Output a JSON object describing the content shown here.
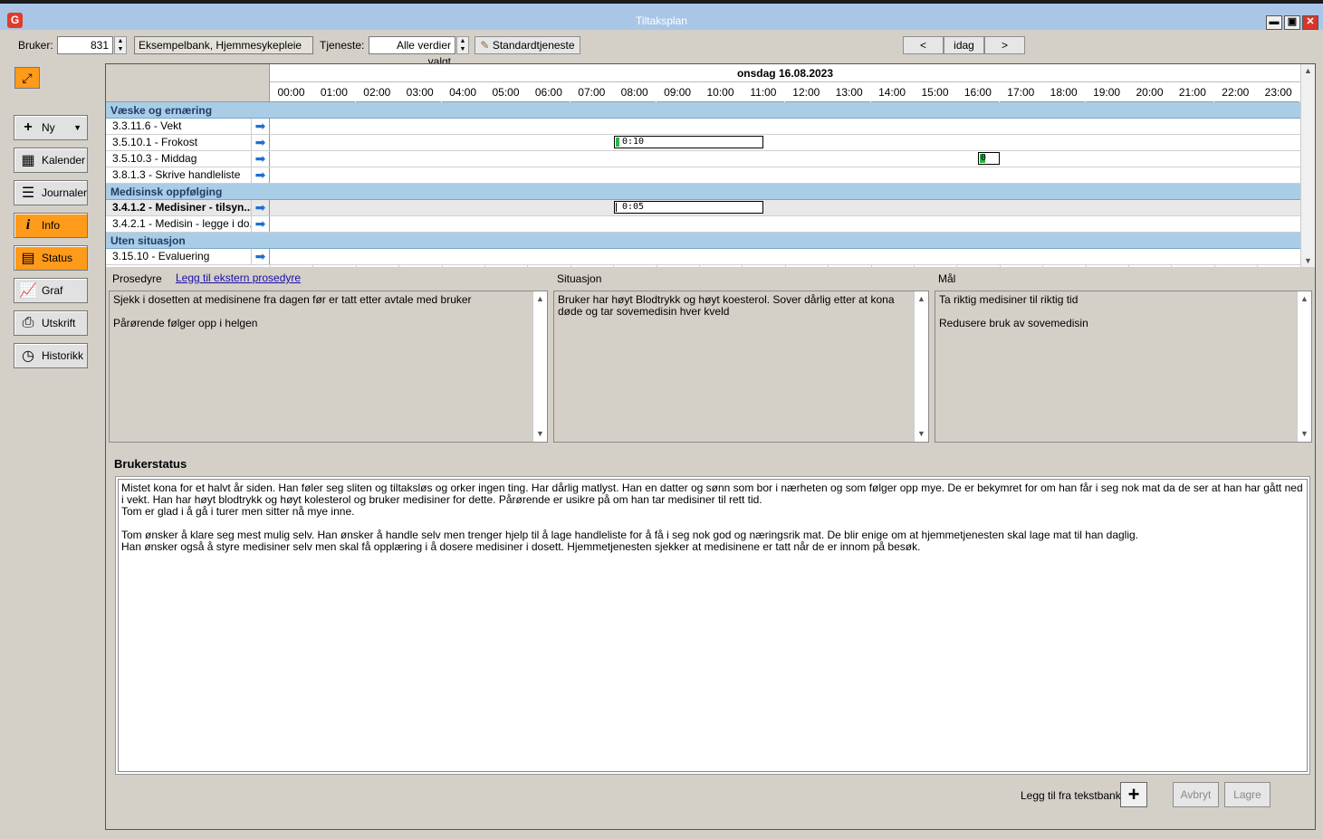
{
  "window": {
    "title": "Tiltaksplan",
    "logo": "G"
  },
  "toolbar": {
    "bruker_label": "Bruker:",
    "bruker_value": "831",
    "bruker_name": "Eksempelbank, Hjemmesykepleie",
    "tjeneste_label": "Tjeneste:",
    "tjeneste_value": "Alle verdier valgt",
    "standard_label": "Standardtjeneste",
    "prev_label": "<",
    "today_label": "idag",
    "next_label": ">"
  },
  "nav": {
    "items": [
      {
        "label": "Ny",
        "icon": "plus-icon"
      },
      {
        "label": "Kalender",
        "icon": "calendar-icon"
      },
      {
        "label": "Journaler",
        "icon": "journal-icon"
      },
      {
        "label": "Info",
        "icon": "info-icon"
      },
      {
        "label": "Status",
        "icon": "status-icon"
      },
      {
        "label": "Graf",
        "icon": "graph-icon"
      },
      {
        "label": "Utskrift",
        "icon": "printer-icon"
      },
      {
        "label": "Historikk",
        "icon": "clock-icon"
      }
    ]
  },
  "schedule": {
    "date": "onsdag 16.08.2023",
    "hours": [
      "00:00",
      "01:00",
      "02:00",
      "03:00",
      "04:00",
      "05:00",
      "06:00",
      "07:00",
      "08:00",
      "09:00",
      "10:00",
      "11:00",
      "12:00",
      "13:00",
      "14:00",
      "15:00",
      "16:00",
      "17:00",
      "18:00",
      "19:00",
      "20:00",
      "21:00",
      "22:00",
      "23:00"
    ],
    "groups": [
      {
        "name": "Væske og ernæring",
        "tasks": [
          {
            "label": "3.3.11.6 - Vekt"
          },
          {
            "label": "3.5.10.1 - Frokost",
            "bar_text": "0:10"
          },
          {
            "label": "3.5.10.3 - Middag",
            "bar_text": "0"
          },
          {
            "label": "3.8.1.3 - Skrive handleliste"
          }
        ]
      },
      {
        "name": "Medisinsk oppfølging",
        "tasks": [
          {
            "label": "3.4.1.2 - Medisiner - tilsyn...",
            "bar_text": "0:05"
          },
          {
            "label": "3.4.2.1 - Medisin - legge i do..."
          }
        ]
      },
      {
        "name": "Uten situasjon",
        "tasks": [
          {
            "label": "3.15.10 - Evaluering"
          }
        ]
      }
    ]
  },
  "prosedyre": {
    "label": "Prosedyre",
    "link": "Legg til ekstern prosedyre",
    "lines": [
      "Sjekk i dosetten at medisinene fra dagen før er tatt etter avtale  med bruker",
      "Pårørende følger opp i helgen"
    ]
  },
  "situasjon": {
    "label": "Situasjon",
    "lines": [
      "Bruker har høyt Blodtrykk og høyt koesterol. Sover dårlig etter at kona døde og tar sovemedisin hver kveld"
    ]
  },
  "maal": {
    "label": "Mål",
    "lines": [
      "Ta riktig medisiner til riktig tid",
      "Redusere bruk av sovemedisin"
    ]
  },
  "brukerstatus": {
    "title": "Brukerstatus",
    "lines": [
      "Mistet kona for et halvt år siden. Han føler seg sliten og tiltaksløs og orker ingen ting. Har dårlig matlyst. Han en datter og sønn som bor i nærheten og som følger opp mye. De er bekymret for om han får i seg nok mat da de ser at han har gått ned i vekt. Han har høyt blodtrykk og høyt kolesterol og bruker medisiner for dette. Pårørende er usikre på om han tar medisiner til rett tid.",
      "Tom er glad i å gå i turer men sitter nå mye inne.",
      "",
      "Tom ønsker å klare seg mest mulig selv. Han ønsker å handle selv men trenger hjelp til å lage handleliste for å få i seg nok god og næringsrik mat. De blir enige om at hjemmetjenesten skal lage mat til han daglig.",
      "Han ønsker også å styre medisiner selv men skal få opplæring i å dosere medisiner i dosett. Hjemmetjenesten sjekker at medisinene er tatt når de er innom på besøk."
    ]
  },
  "footer": {
    "tekstbank_label": "Legg til fra tekstbank",
    "avbryt_label": "Avbryt",
    "lagre_label": "Lagre"
  }
}
